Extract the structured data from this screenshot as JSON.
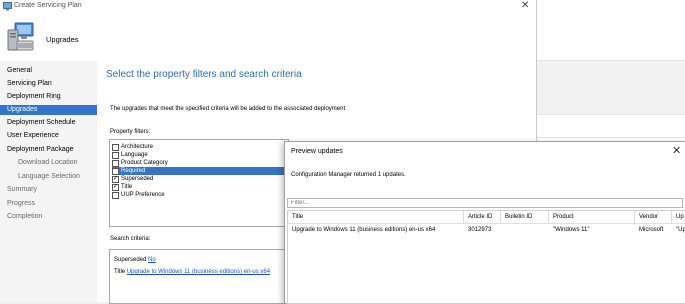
{
  "window": {
    "title": "Create Servicing Plan",
    "close_glyph": "✕"
  },
  "banner": {
    "label": "Upgrades",
    "icon": "computer-icon"
  },
  "nav": {
    "items": [
      {
        "label": "General",
        "state": "normal"
      },
      {
        "label": "Servicing Plan",
        "state": "normal"
      },
      {
        "label": "Deployment Ring",
        "state": "normal"
      },
      {
        "label": "Upgrades",
        "state": "active"
      },
      {
        "label": "Deployment Schedule",
        "state": "normal"
      },
      {
        "label": "User Experience",
        "state": "normal"
      },
      {
        "label": "Deployment Package",
        "state": "normal"
      },
      {
        "label": "Download Location",
        "state": "sub"
      },
      {
        "label": "Language Selection",
        "state": "sub"
      },
      {
        "label": "Summary",
        "state": "dim"
      },
      {
        "label": "Progress",
        "state": "dim"
      },
      {
        "label": "Completion",
        "state": "dim"
      }
    ]
  },
  "main": {
    "heading": "Select the property filters and search criteria",
    "description": "The upgrades that meet the specified criteria will be added to the associated deployment",
    "property_filters_label": "Property filters:",
    "property_filters": [
      {
        "label": "Architecture",
        "checked": false,
        "selected": false
      },
      {
        "label": "Language",
        "checked": false,
        "selected": false
      },
      {
        "label": "Product Category",
        "checked": false,
        "selected": false
      },
      {
        "label": "Required",
        "checked": false,
        "selected": true
      },
      {
        "label": "Superseded",
        "checked": true,
        "selected": false
      },
      {
        "label": "Title",
        "checked": true,
        "selected": false
      },
      {
        "label": "UUP Preference",
        "checked": false,
        "selected": false
      }
    ],
    "search_criteria_label": "Search criteria:",
    "criteria": [
      {
        "name": "Superseded",
        "value": "No"
      },
      {
        "name": "Title",
        "value": "Upgrade to Windows 11 (business editions) en-us x64"
      }
    ]
  },
  "preview": {
    "title": "Preview updates",
    "close_glyph": "✕",
    "message": "Configuration Manager returned 1 updates.",
    "filter_placeholder": "Filter...",
    "columns": [
      "Title",
      "Article ID",
      "Bulletin ID",
      "Product",
      "Vendor",
      "Up"
    ],
    "rows": [
      [
        "Upgrade to Windows 11 (business editions) en-us x64",
        "3012973",
        "",
        "\"Windows 11\"",
        "Microsoft",
        "\"Up"
      ]
    ]
  },
  "colors": {
    "accent": "#3574c8",
    "heading": "#2a6fb3",
    "link": "#1a4fd6"
  }
}
